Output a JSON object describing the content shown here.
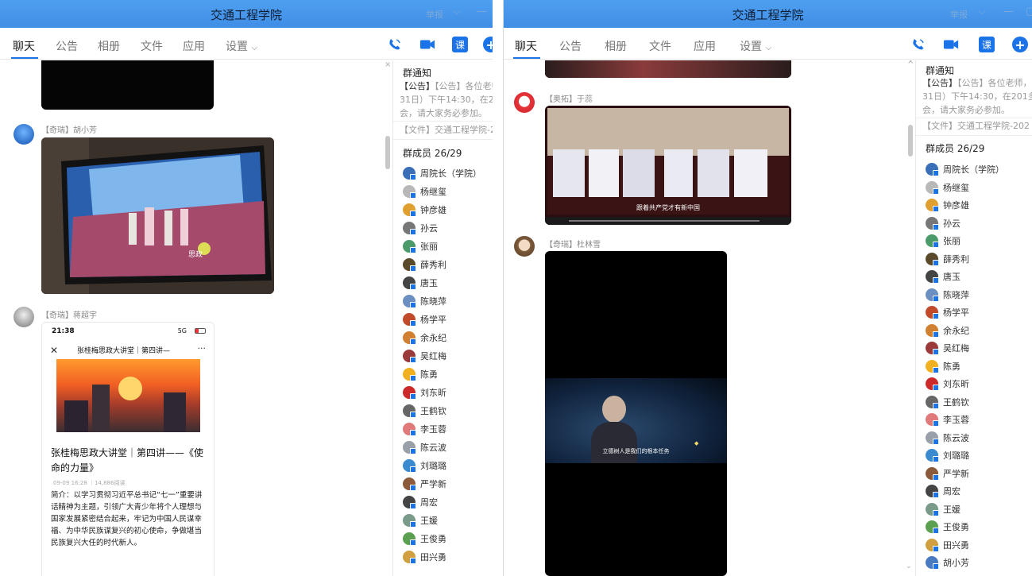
{
  "window_title": "交通工程学院",
  "report_label": "举报",
  "tabs": [
    "聊天",
    "公告",
    "相册",
    "文件",
    "应用",
    "设置"
  ],
  "toolbar_icons": [
    "phone-icon",
    "video-icon",
    "course-icon",
    "add-icon"
  ],
  "course_label": "课",
  "side": {
    "notice_title": "群通知",
    "notice_left": [
      "【公告】各位老师，今天",
      "31日）下午14:30，在20",
      "会，请大家务必参加。"
    ],
    "notice_right": [
      "【公告】各位老师，今天（",
      "31日）下午14:30，在201多",
      "会，请大家务必参加。"
    ],
    "file_left": "【文件】交通工程学院-2",
    "file_right": "【文件】交通工程学院-202",
    "members_title": "群成员 26/29",
    "members_left": [
      "周院长（学院）",
      "杨继玺",
      "钟彦雄",
      "孙云",
      "张丽",
      "薛秀利",
      "唐玉",
      "陈晓萍",
      "杨学平",
      "余永纪",
      "吴红梅",
      "陈勇",
      "刘东昕",
      "王鹤钦",
      "李玉蓉",
      "陈云波",
      "刘璐璐",
      "严学新",
      "周宏",
      "王媛",
      "王俊勇",
      "田兴勇"
    ],
    "members_right": [
      "周院长（学院）",
      "杨继玺",
      "钟彦雄",
      "孙云",
      "张丽",
      "薛秀利",
      "唐玉",
      "陈晓萍",
      "杨学平",
      "余永纪",
      "吴红梅",
      "陈勇",
      "刘东昕",
      "王鹤钦",
      "李玉蓉",
      "陈云波",
      "刘璐璐",
      "严学新",
      "周宏",
      "王媛",
      "王俊勇",
      "田兴勇",
      "胡小芳"
    ]
  },
  "left_chat": {
    "sender1": "【奇瑞】胡小芳",
    "sender2": "【奇瑞】蒋超宇",
    "phone_time": "21:38",
    "phone_status": "5G",
    "article_header": "张桂梅思政大讲堂｜第四讲—",
    "article_title": "张桂梅思政大讲堂｜第四讲——《使命的力量》",
    "article_meta": "09-09 16:28  ｜14,886阅读",
    "article_body": "简介：以学习贯彻习近平总书记“七一”重要讲话精神为主题，引领广大青少年将个人理想与国家发展紧密结合起来，牢记为中国人民谋幸福、为中华民族谋复兴的初心使命，争做堪当民族复兴大任的时代新人。"
  },
  "right_chat": {
    "sender1": "【奥拓】于蕊",
    "sender2": "【奇瑞】杜林雪",
    "video1_caption": "跟着共产党才有新中国",
    "video2_caption": "立德树人是我们的根本任务"
  }
}
